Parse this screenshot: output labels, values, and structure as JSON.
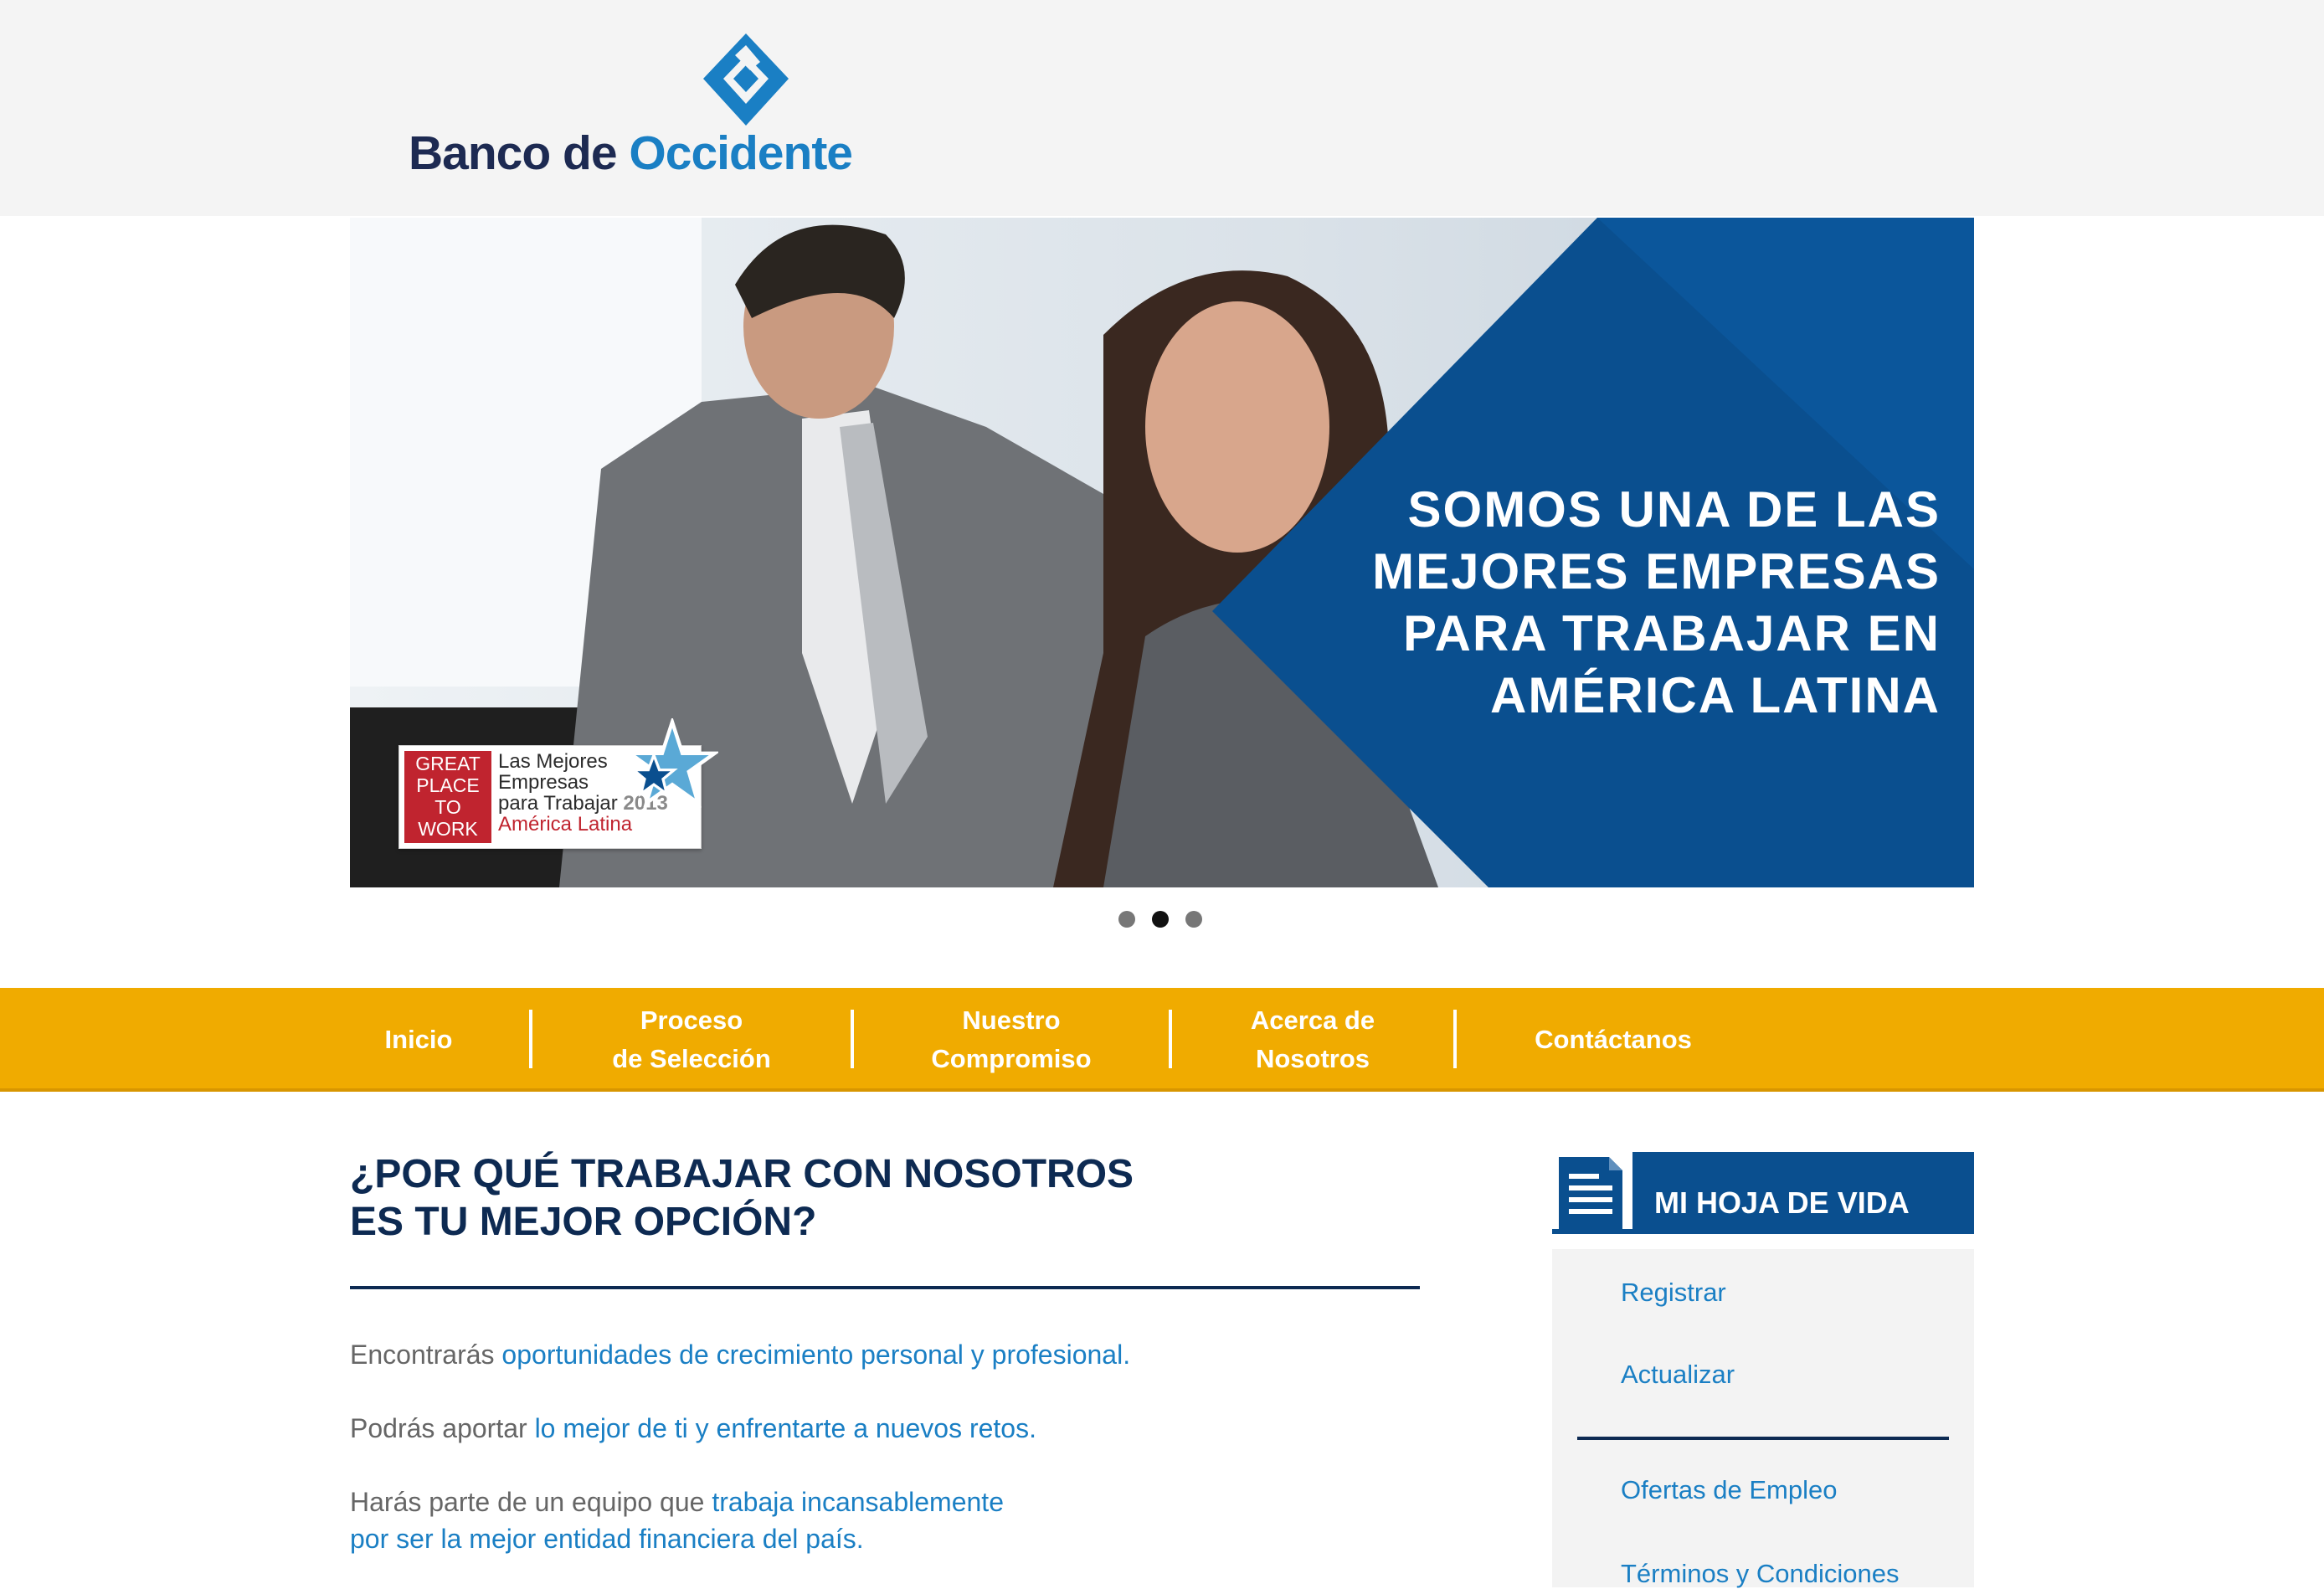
{
  "brand": {
    "name_part1": "Banco de",
    "name_part2": "Occidente",
    "colors": {
      "navy": "#1d2a52",
      "blue": "#1a7fc4",
      "nav_yellow": "#f0ab00",
      "banner_blue": "#0a4f8f"
    }
  },
  "banner": {
    "headline": "SOMOS UNA DE LAS MEJORES EMPRESAS PARA TRABAJAR EN AMÉRICA LATINA",
    "award": {
      "badge_lines": [
        "GREAT",
        "PLACE",
        "TO",
        "WORK"
      ],
      "line1": "Las Mejores",
      "line2": "Empresas",
      "line3": "para Trabajar",
      "year": "2013",
      "region": "América Latina"
    },
    "slides": {
      "count": 3,
      "active_index": 2
    }
  },
  "nav": {
    "items": [
      {
        "label": "Inicio"
      },
      {
        "label": "Proceso\nde Selección"
      },
      {
        "label": "Nuestro\nCompromiso"
      },
      {
        "label": "Acerca de\nNosotros"
      },
      {
        "label": "Contáctanos"
      }
    ]
  },
  "main": {
    "title": "¿POR QUÉ TRABAJAR CON NOSOTROS\nES TU MEJOR OPCIÓN?",
    "paragraphs": [
      {
        "prefix": "Encontrarás ",
        "highlight": "oportunidades de crecimiento personal y profesional."
      },
      {
        "prefix": "Podrás aportar ",
        "highlight": "lo mejor de ti y enfrentarte a nuevos retos."
      },
      {
        "prefix": "Harás parte de un equipo que ",
        "highlight": "trabaja incansablemente",
        "line2": "por ser la mejor entidad financiera del país."
      }
    ]
  },
  "sidebar": {
    "title": "MI HOJA DE VIDA",
    "links": [
      {
        "label": "Registrar"
      },
      {
        "label": "Actualizar"
      },
      {
        "label": "Ofertas de Empleo"
      },
      {
        "label": "Términos y Condiciones"
      }
    ]
  }
}
